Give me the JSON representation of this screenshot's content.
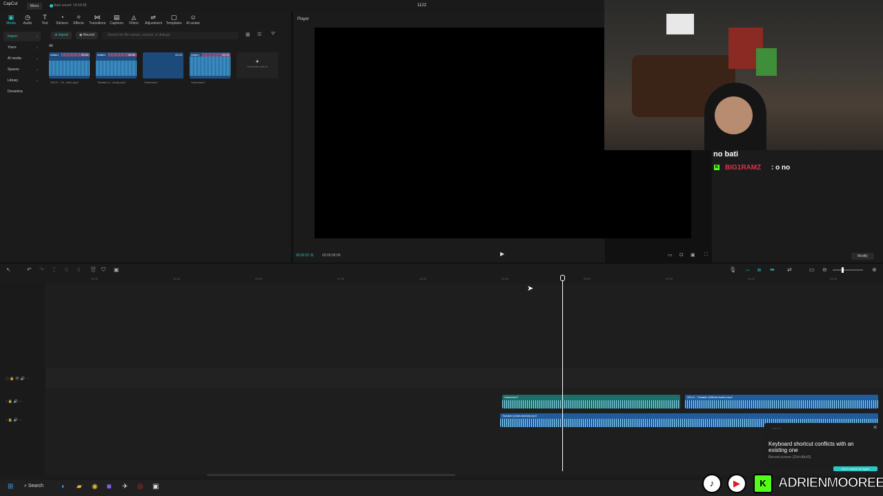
{
  "titlebar": {
    "app_name": "CapCut",
    "menu_label": "Menu",
    "autosave": "Auto saved: 15:54:39",
    "project_name": "1122"
  },
  "toolbar": {
    "items": [
      {
        "label": "Media",
        "icon": "media-icon"
      },
      {
        "label": "Audio",
        "icon": "audio-icon"
      },
      {
        "label": "Text",
        "icon": "text-icon"
      },
      {
        "label": "Stickers",
        "icon": "stickers-icon"
      },
      {
        "label": "Effects",
        "icon": "effects-icon"
      },
      {
        "label": "Transitions",
        "icon": "transitions-icon"
      },
      {
        "label": "Captions",
        "icon": "captions-icon"
      },
      {
        "label": "Filters",
        "icon": "filters-icon"
      },
      {
        "label": "Adjustment",
        "icon": "adjustment-icon"
      },
      {
        "label": "Templates",
        "icon": "templates-icon"
      },
      {
        "label": "AI avatar",
        "icon": "ai-avatar-icon"
      }
    ]
  },
  "sidebar": {
    "items": [
      {
        "label": "Import"
      },
      {
        "label": "Yours"
      },
      {
        "label": "AI media"
      },
      {
        "label": "Spaces"
      },
      {
        "label": "Library"
      },
      {
        "label": "Dreamina"
      }
    ]
  },
  "media": {
    "import_label": "Import",
    "record_label": "Record",
    "search_placeholder": "Search for file names, scenes, or dialogs",
    "filter_label": "All",
    "generate_label": "Generate with AI",
    "items": [
      {
        "name": "GELO - Tw...udio).mp3",
        "added": "Added",
        "duration": "03:04"
      },
      {
        "name": "Tweaker (I...ental).mp3",
        "added": "Added",
        "duration": "02:50"
      },
      {
        "name": "Voiceover1",
        "added": "",
        "duration": "00:20"
      },
      {
        "name": "Voiceover2",
        "added": "Added",
        "duration": "00:03"
      }
    ]
  },
  "player": {
    "title": "Player",
    "current_time": "00:02:07:11",
    "total_time": "00:05:09:09"
  },
  "chat": {
    "line1": "no bati",
    "username": "BIG1RAMZ",
    "message": ": o no",
    "badge": "K"
  },
  "modify_label": "Modify",
  "timeline": {
    "ruler": [
      "00:00",
      "00:30",
      "01:00",
      "01:30",
      "02:00",
      "02:30",
      "03:00",
      "03:30",
      "04:00",
      "04:30"
    ],
    "clips": [
      {
        "name": "Voiceover2"
      },
      {
        "name": "GELO - Tweaker (Official Audio).mp3"
      },
      {
        "name": "Tweaker (Instrumental).mp3"
      }
    ]
  },
  "toast": {
    "app": "CapCut",
    "message": "Keyboard shortcut conflicts with an existing one",
    "hint": "Record screen: [Ctrl+Alt+R]",
    "button": "Don't remind me again"
  },
  "taskbar": {
    "search": "Search"
  },
  "social": {
    "name": "ADRIENMOOREEE"
  }
}
